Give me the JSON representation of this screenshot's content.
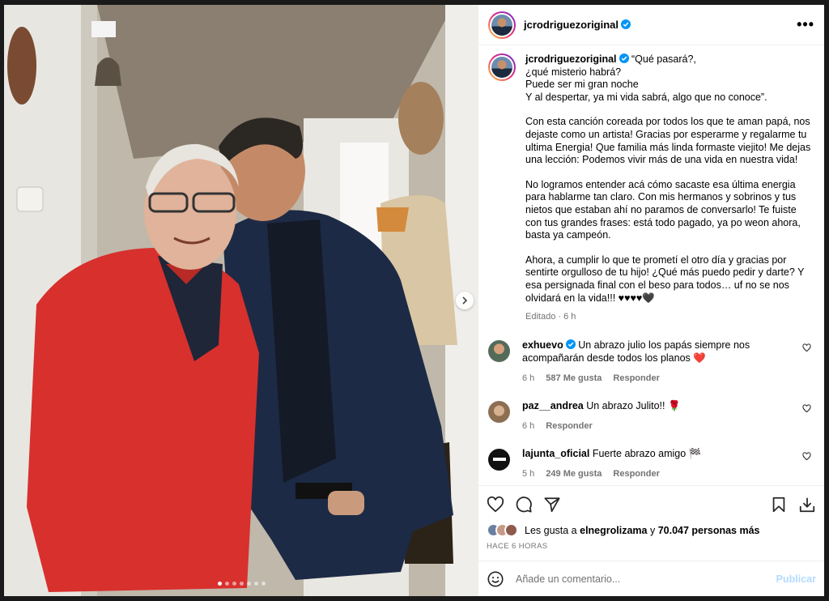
{
  "post": {
    "username": "jcrodriguezoriginal",
    "more_label": "•••",
    "caption_paragraphs": [
      "“Qué pasará?,\n¿qué misterio habrá?\nPuede ser mi gran noche\nY al despertar, ya mi vida sabrá, algo que no conoce”.",
      "Con esta canción coreada por todos los que te aman papá, nos dejaste como un artista! Gracias por esperarme y regalarme tu ultima Energia! Que familia más linda formaste viejito! Me dejas una lección: Podemos vivir más de una vida en nuestra vida!",
      "No logramos entender acá cómo sacaste esa última energia para hablarme tan claro. Con mis hermanos y sobrinos y tus nietos que estaban ahí no paramos de conversarlo! Te fuiste con tus grandes frases: está todo pagado, ya po weon ahora, basta ya campeón.",
      "Ahora, a cumplir lo que te prometí el otro día y gracias por sentirte orgulloso de tu hijo! ¿Qué más puedo pedir y darte? Y esa persignada final con el beso para todos… uf no se nos olvidará en la vida!!! ♥♥♥♥🖤"
    ],
    "edited_label": "Editado · 6 h",
    "carousel": {
      "total": 7,
      "active": 0
    }
  },
  "comments": [
    {
      "user": "exhuevo",
      "verified": true,
      "text": "Un abrazo julio los papás siempre nos acompañarán desde todos los planos ❤️",
      "time": "6 h",
      "likes": "587 Me gusta",
      "reply": "Responder",
      "avatar_color": "#8a6a4f"
    },
    {
      "user": "paz__andrea",
      "verified": false,
      "text": "Un abrazo Julito!! 🌹",
      "time": "6 h",
      "likes": "",
      "reply": "Responder",
      "avatar_color": "#b78b6d"
    },
    {
      "user": "lajunta_oficial",
      "verified": false,
      "text": "Fuerte abrazo amigo 🏁",
      "time": "5 h",
      "likes": "249 Me gusta",
      "reply": "Responder",
      "avatar_color": "#111111"
    }
  ],
  "likes": {
    "prefix": "Les gusta a",
    "user": "elnegrolizama",
    "middle": "y",
    "count": "70.047 personas más",
    "time_ago": "HACE 6 HORAS"
  },
  "composer": {
    "placeholder": "Añade un comentario...",
    "publish": "Publicar"
  },
  "icons": [
    "heart-icon",
    "comment-icon",
    "share-icon",
    "bookmark-icon",
    "download-icon",
    "emoji-icon",
    "more-icon",
    "verified-icon",
    "chevron-right-icon"
  ],
  "colors": {
    "verified": "#0095f6",
    "publish_disabled": "#b3dbff",
    "muted": "#737373"
  }
}
